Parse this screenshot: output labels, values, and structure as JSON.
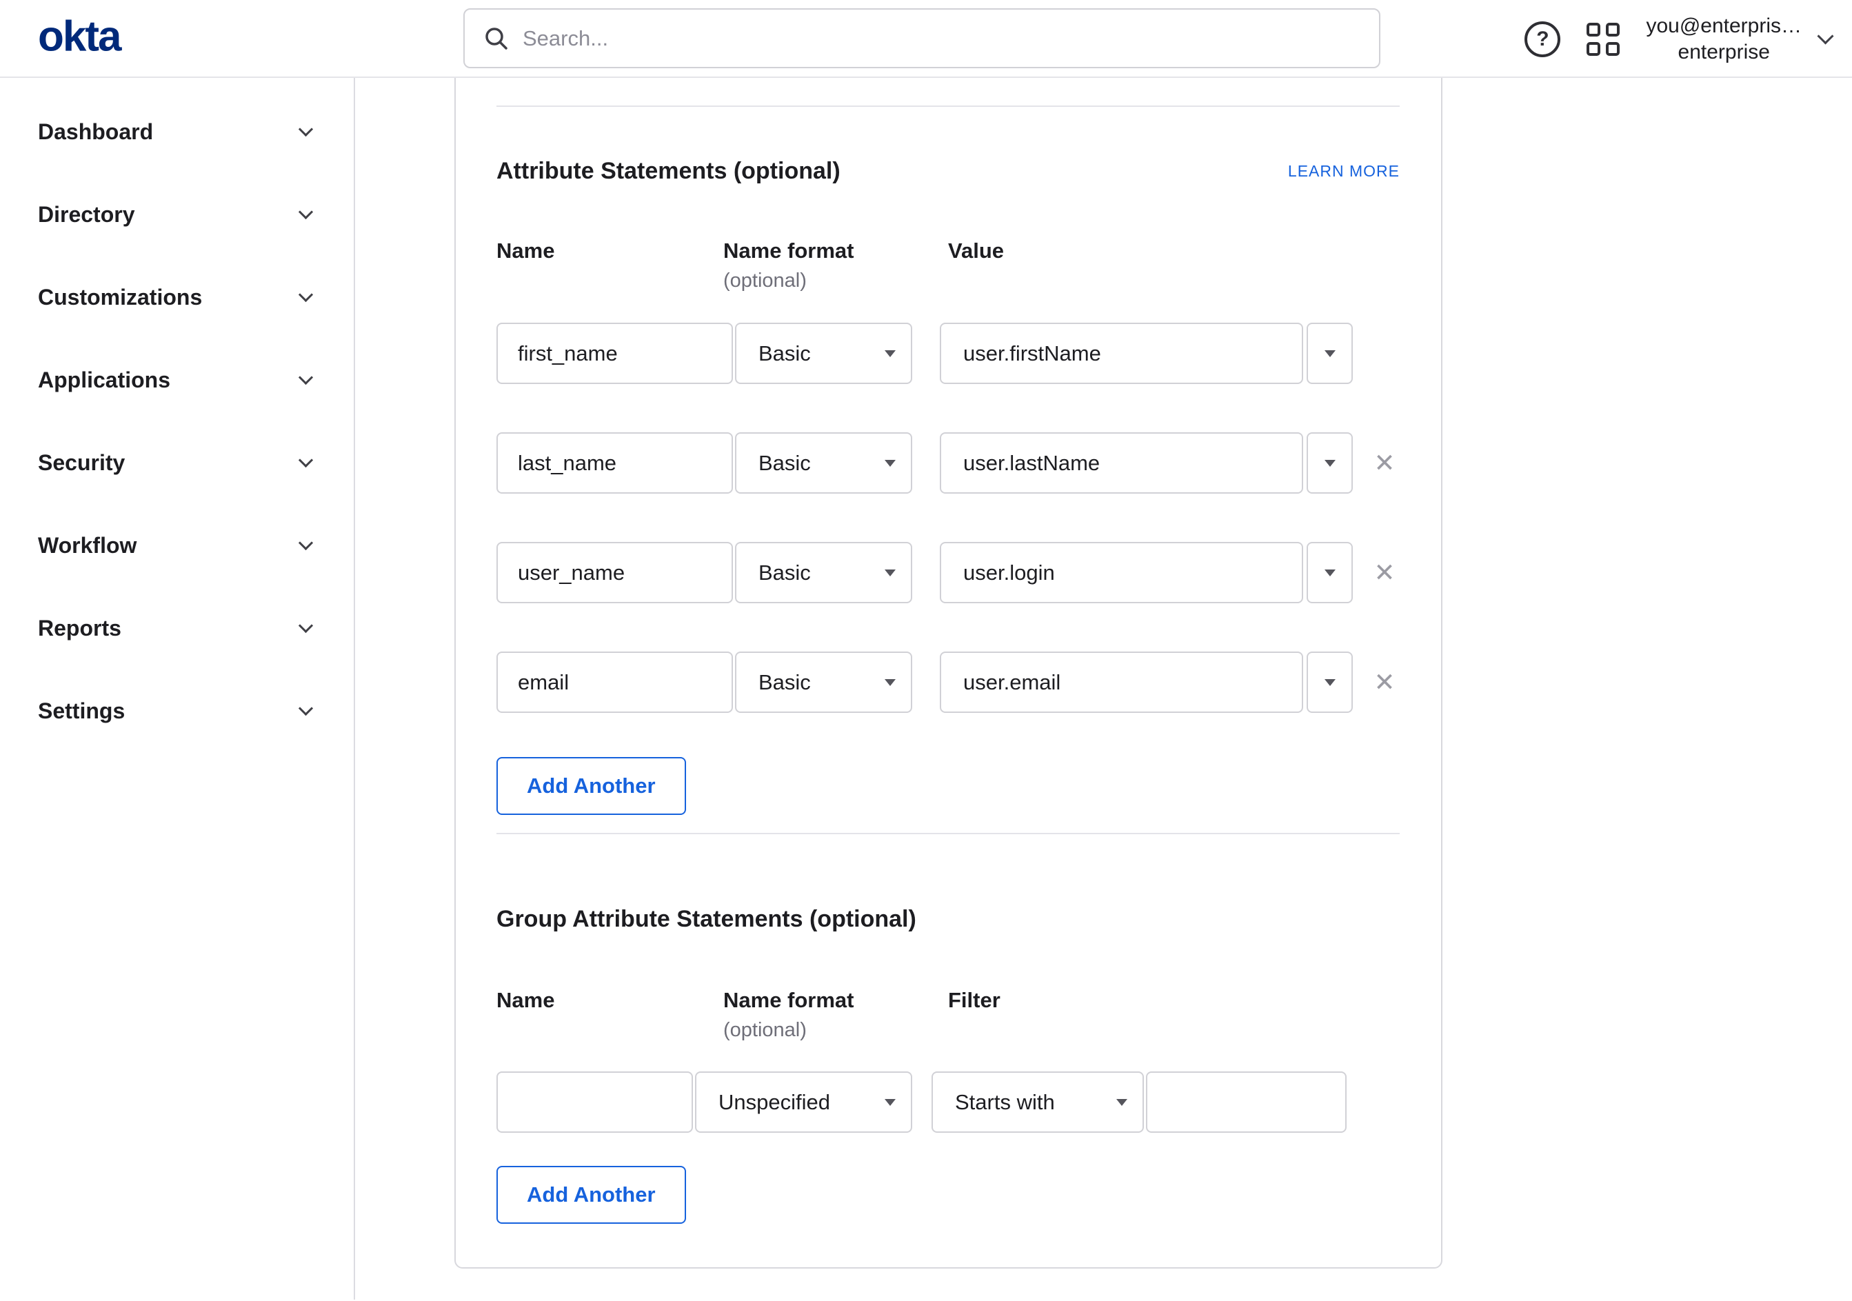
{
  "header": {
    "logo": "okta",
    "search_placeholder": "Search...",
    "user_line1": "you@enterpris…",
    "user_line2": "enterprise"
  },
  "sidebar": {
    "items": [
      "Dashboard",
      "Directory",
      "Customizations",
      "Applications",
      "Security",
      "Workflow",
      "Reports",
      "Settings"
    ]
  },
  "attr": {
    "title": "Attribute Statements (optional)",
    "learn_more": "LEARN MORE",
    "col_name": "Name",
    "col_format": "Name format",
    "col_format_note": "(optional)",
    "col_value": "Value",
    "rows": [
      {
        "name": "first_name",
        "format": "Basic",
        "value": "user.firstName"
      },
      {
        "name": "last_name",
        "format": "Basic",
        "value": "user.lastName"
      },
      {
        "name": "user_name",
        "format": "Basic",
        "value": "user.login"
      },
      {
        "name": "email",
        "format": "Basic",
        "value": "user.email"
      }
    ],
    "add_button": "Add Another"
  },
  "group": {
    "title": "Group Attribute Statements (optional)",
    "col_name": "Name",
    "col_format": "Name format",
    "col_format_note": "(optional)",
    "col_filter": "Filter",
    "row": {
      "name": "",
      "format": "Unspecified",
      "filter": "Starts with",
      "value": ""
    },
    "add_button": "Add Another"
  },
  "icons": {
    "close": "✕",
    "help": "?"
  },
  "colors": {
    "accent": "#1662dd",
    "logo_blue": "#00297a",
    "text": "#1d1d21",
    "muted": "#6e6e78"
  }
}
